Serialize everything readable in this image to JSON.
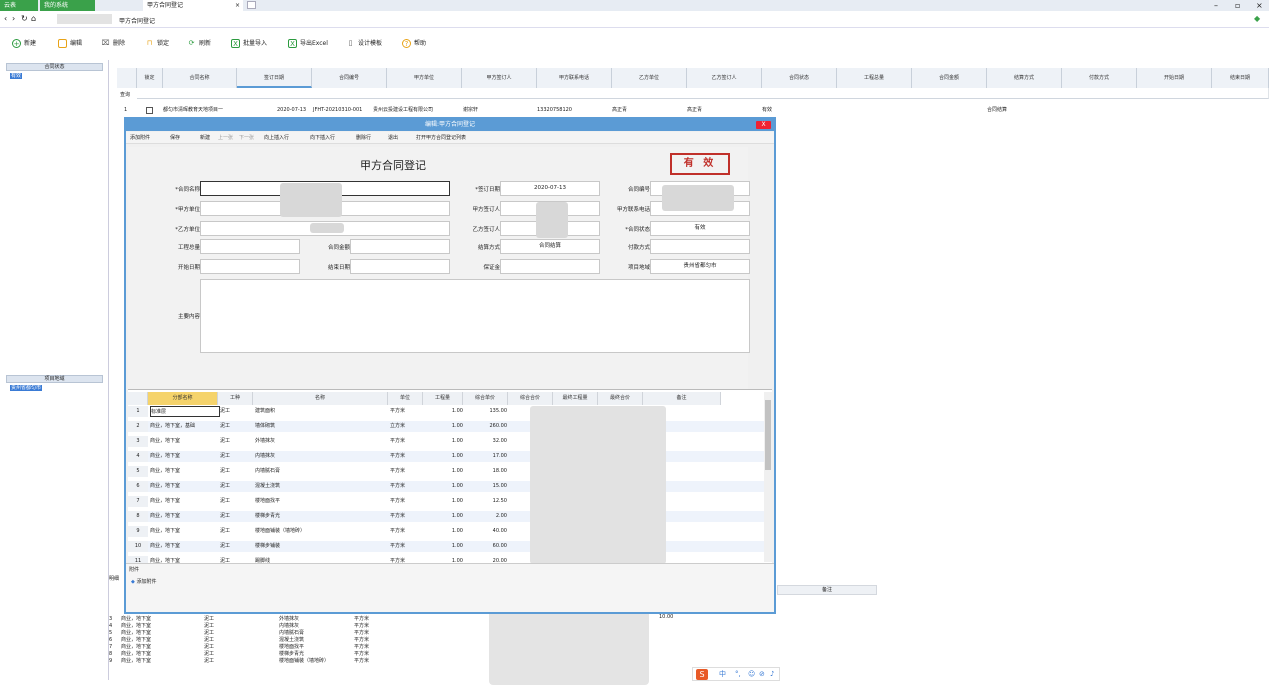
{
  "titlebar": {
    "app": "云表",
    "tab1": "我的系统",
    "tab2": "甲方合同登记",
    "close": "×"
  },
  "addr": {
    "page": "甲方合同登记"
  },
  "toolbar": {
    "new": "新建",
    "edit": "编辑",
    "delete": "删除",
    "lock": "锁定",
    "refresh": "刷新",
    "import": "批量导入",
    "export": "导出Excel",
    "design": "设计模板",
    "help": "帮助"
  },
  "left": {
    "head1": "合同状态",
    "item1": "有效",
    "head2": "项目地域",
    "item2": "贵州省都匀市"
  },
  "grid": {
    "headers": [
      "锁定",
      "合同名称",
      "签订日期",
      "合同编号",
      "甲方单位",
      "甲方签订人",
      "甲方联系电话",
      "乙方单位",
      "乙方签订人",
      "合同状态",
      "工程总量",
      "合同金额",
      "结算方式",
      "付款方式",
      "开始日期",
      "结束日期"
    ],
    "filter_label": "查询",
    "row": {
      "idx": "1",
      "name": "都匀市清晖教育天地项目一",
      "date": "2020-07-13",
      "code": "JFHT-20210310-001",
      "party_a": "贵州云投建设工程有限公司",
      "signer_a": "谢宗轩",
      "phone": "13320758120",
      "party_b": "高正青",
      "signer_b": "高正青",
      "status": "有效",
      "settle": "合同结算"
    }
  },
  "dialog": {
    "title": "编辑:甲方合同登记",
    "close": "X",
    "tools": [
      "添加附件",
      "保存",
      "新建",
      "上一张",
      "下一张",
      "向上插入行",
      "向下插入行",
      "删除行",
      "退出",
      "打开甲方合同登记列表"
    ],
    "form_title": "甲方合同登记",
    "stamp": "有 效",
    "labels": {
      "name": "*合同名称",
      "date": "*签订日期",
      "code": "合同编号",
      "party_a": "*甲方单位",
      "signer_a": "甲方签订人",
      "phone_a": "甲方联系电话",
      "party_b": "*乙方单位",
      "signer_b": "乙方签订人",
      "status": "*合同状态",
      "qty": "工程总量",
      "amount": "合同金额",
      "settle": "结算方式",
      "pay": "付款方式",
      "start": "开始日期",
      "end": "结束日期",
      "deposit": "保证金",
      "region": "项目地域",
      "content": "主要内容"
    },
    "values": {
      "date": "2020-07-13",
      "status": "有效",
      "settle": "合同结算",
      "region": "贵州省都匀市"
    },
    "detail_headers": [
      "分部名称",
      "工种",
      "名称",
      "单位",
      "工程量",
      "综合单价",
      "综合合价",
      "最终工程量",
      "最终合价",
      "备注"
    ],
    "detail_rows": [
      [
        "1",
        "标准层",
        "泥工",
        "建筑面积",
        "平方米",
        "1.00",
        "135.00"
      ],
      [
        "2",
        "商业，地下室，基础",
        "泥工",
        "墙体砌筑",
        "立方米",
        "1.00",
        "260.00"
      ],
      [
        "3",
        "商业，地下室",
        "泥工",
        "外墙抹灰",
        "平方米",
        "1.00",
        "32.00"
      ],
      [
        "4",
        "商业，地下室",
        "泥工",
        "内墙抹灰",
        "平方米",
        "1.00",
        "17.00"
      ],
      [
        "5",
        "商业，地下室",
        "泥工",
        "内墙腻石膏",
        "平方米",
        "1.00",
        "18.00"
      ],
      [
        "6",
        "商业，地下室",
        "泥工",
        "混凝土浇筑",
        "平方米",
        "1.00",
        "15.00"
      ],
      [
        "7",
        "商业，地下室",
        "泥工",
        "楼地面找平",
        "平方米",
        "1.00",
        "12.50"
      ],
      [
        "8",
        "商业，地下室",
        "泥工",
        "楼梯步青光",
        "平方米",
        "1.00",
        "2.00"
      ],
      [
        "9",
        "商业，地下室",
        "泥工",
        "楼地面铺装（墙地砖）",
        "平方米",
        "1.00",
        "40.00"
      ],
      [
        "10",
        "商业，地下室",
        "泥工",
        "楼梯步铺装",
        "平方米",
        "1.00",
        "60.00"
      ],
      [
        "11",
        "商业，地下室",
        "泥工",
        "踢脚线",
        "平方米",
        "1.00",
        "20.00"
      ]
    ],
    "attach_tab": "附件",
    "attach_btn": "添加附件"
  },
  "bottom": {
    "tab": "明细",
    "rows": [
      [
        "3",
        "商业，地下室",
        "泥工",
        "外墙抹灰",
        "平方米"
      ],
      [
        "4",
        "商业，地下室",
        "泥工",
        "内墙抹灰",
        "平方米"
      ],
      [
        "5",
        "商业，地下室",
        "泥工",
        "内墙腻石膏",
        "平方米"
      ],
      [
        "6",
        "商业，地下室",
        "泥工",
        "混凝土浇筑",
        "平方米"
      ],
      [
        "7",
        "商业，地下室",
        "泥工",
        "楼地面找平",
        "平方米"
      ],
      [
        "8",
        "商业，地下室",
        "泥工",
        "楼梯步青光",
        "平方米"
      ],
      [
        "9",
        "商业，地下室",
        "泥工",
        "楼地面铺装（墙地砖）",
        "平方米"
      ]
    ],
    "remark_header": "备注",
    "value": "10.00"
  },
  "ime": {
    "brand": "S",
    "label": "中"
  }
}
